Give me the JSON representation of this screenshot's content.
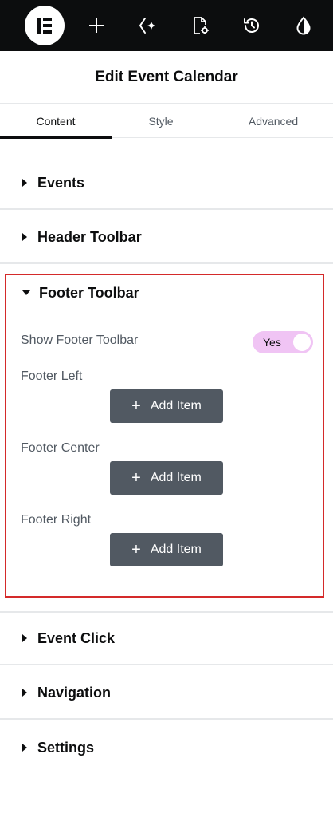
{
  "toolbar": {
    "icons": [
      "elementor-logo-icon",
      "plus-icon",
      "ai-sparkle-icon",
      "page-settings-icon",
      "history-icon",
      "site-settings-icon"
    ]
  },
  "header": {
    "title": "Edit Event Calendar"
  },
  "tabs": [
    {
      "label": "Content",
      "active": true
    },
    {
      "label": "Style",
      "active": false
    },
    {
      "label": "Advanced",
      "active": false
    }
  ],
  "sections": {
    "events": "Events",
    "header_toolbar": "Header Toolbar",
    "footer_toolbar": "Footer Toolbar",
    "event_click": "Event Click",
    "navigation": "Navigation",
    "settings": "Settings"
  },
  "footer_toolbar": {
    "show_label": "Show Footer Toolbar",
    "toggle_value": "Yes",
    "left_label": "Footer Left",
    "center_label": "Footer Center",
    "right_label": "Footer Right",
    "add_item_label": "Add Item"
  },
  "colors": {
    "topbar": "#0c0d0e",
    "highlight_border": "#d42a2a",
    "toggle_on": "#f0c4f4",
    "button": "#515962"
  }
}
